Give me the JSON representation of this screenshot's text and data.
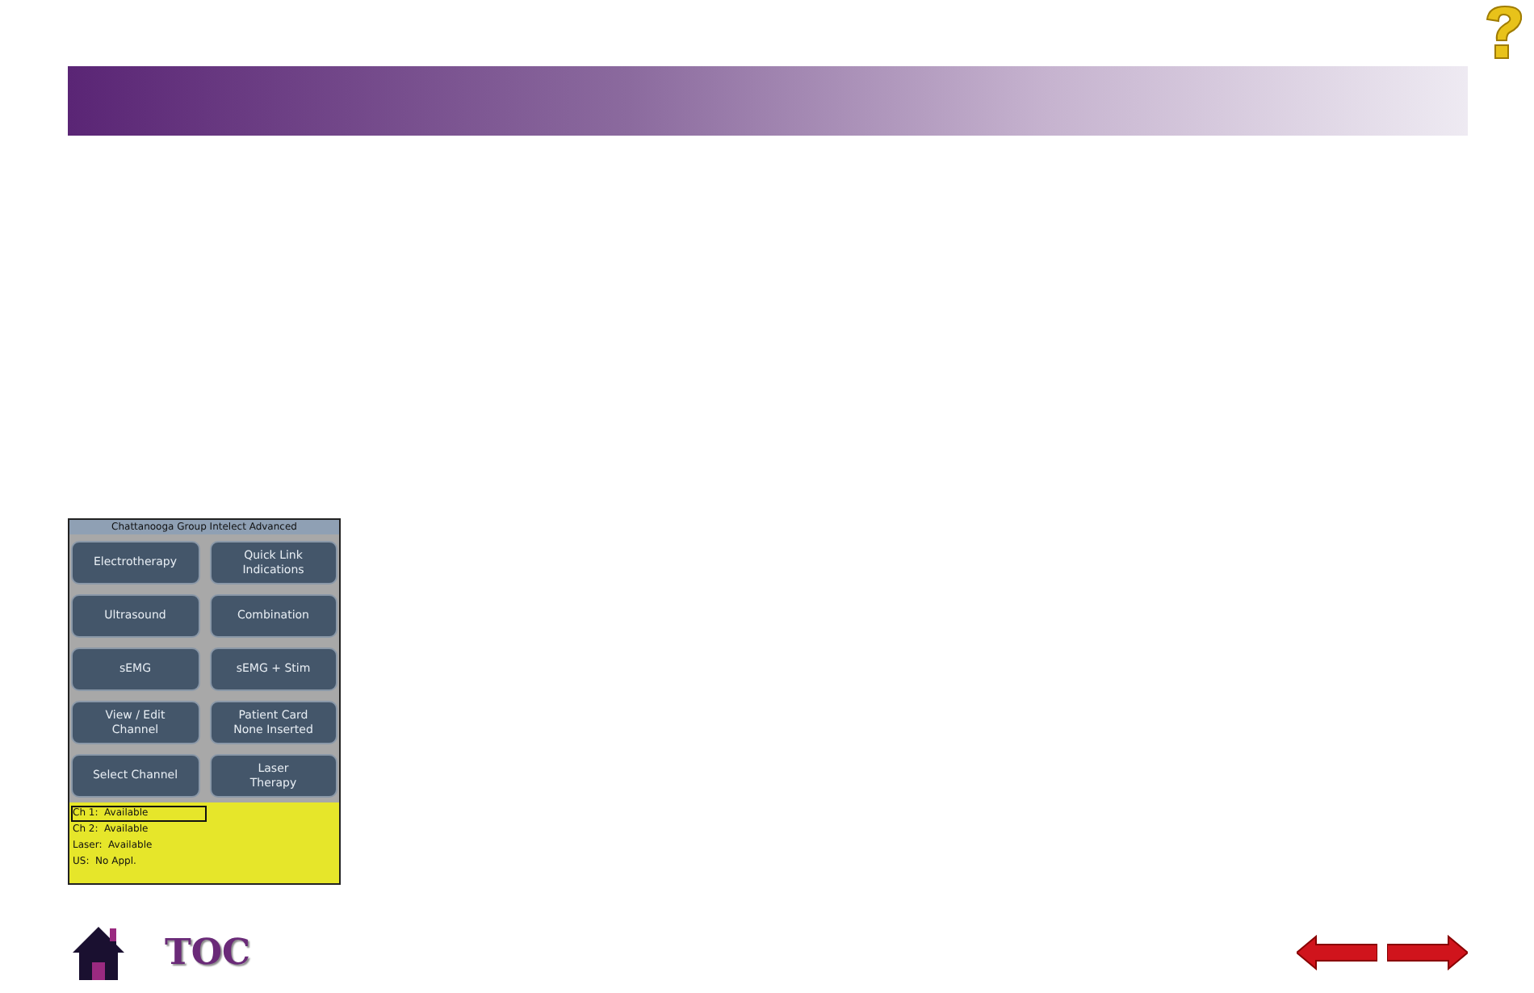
{
  "device": {
    "title": "Chattanooga Group Intelect Advanced",
    "buttons": [
      {
        "label": "Electrotherapy"
      },
      {
        "label": "Quick Link\nIndications"
      },
      {
        "label": "Ultrasound"
      },
      {
        "label": "Combination"
      },
      {
        "label": "sEMG"
      },
      {
        "label": "sEMG + Stim"
      },
      {
        "label": "View / Edit\nChannel"
      },
      {
        "label": "Patient Card\nNone Inserted"
      },
      {
        "label": "Select Channel"
      },
      {
        "label": "Laser\nTherapy"
      }
    ],
    "status": [
      {
        "name": "Ch 1:",
        "value": "Available",
        "selected": true
      },
      {
        "name": "Ch 2:",
        "value": "Available",
        "selected": false
      },
      {
        "name": "Laser:",
        "value": "Available",
        "selected": false
      },
      {
        "name": "US:",
        "value": "No Appl.",
        "selected": false
      }
    ]
  },
  "footer": {
    "toc": "TOC"
  }
}
